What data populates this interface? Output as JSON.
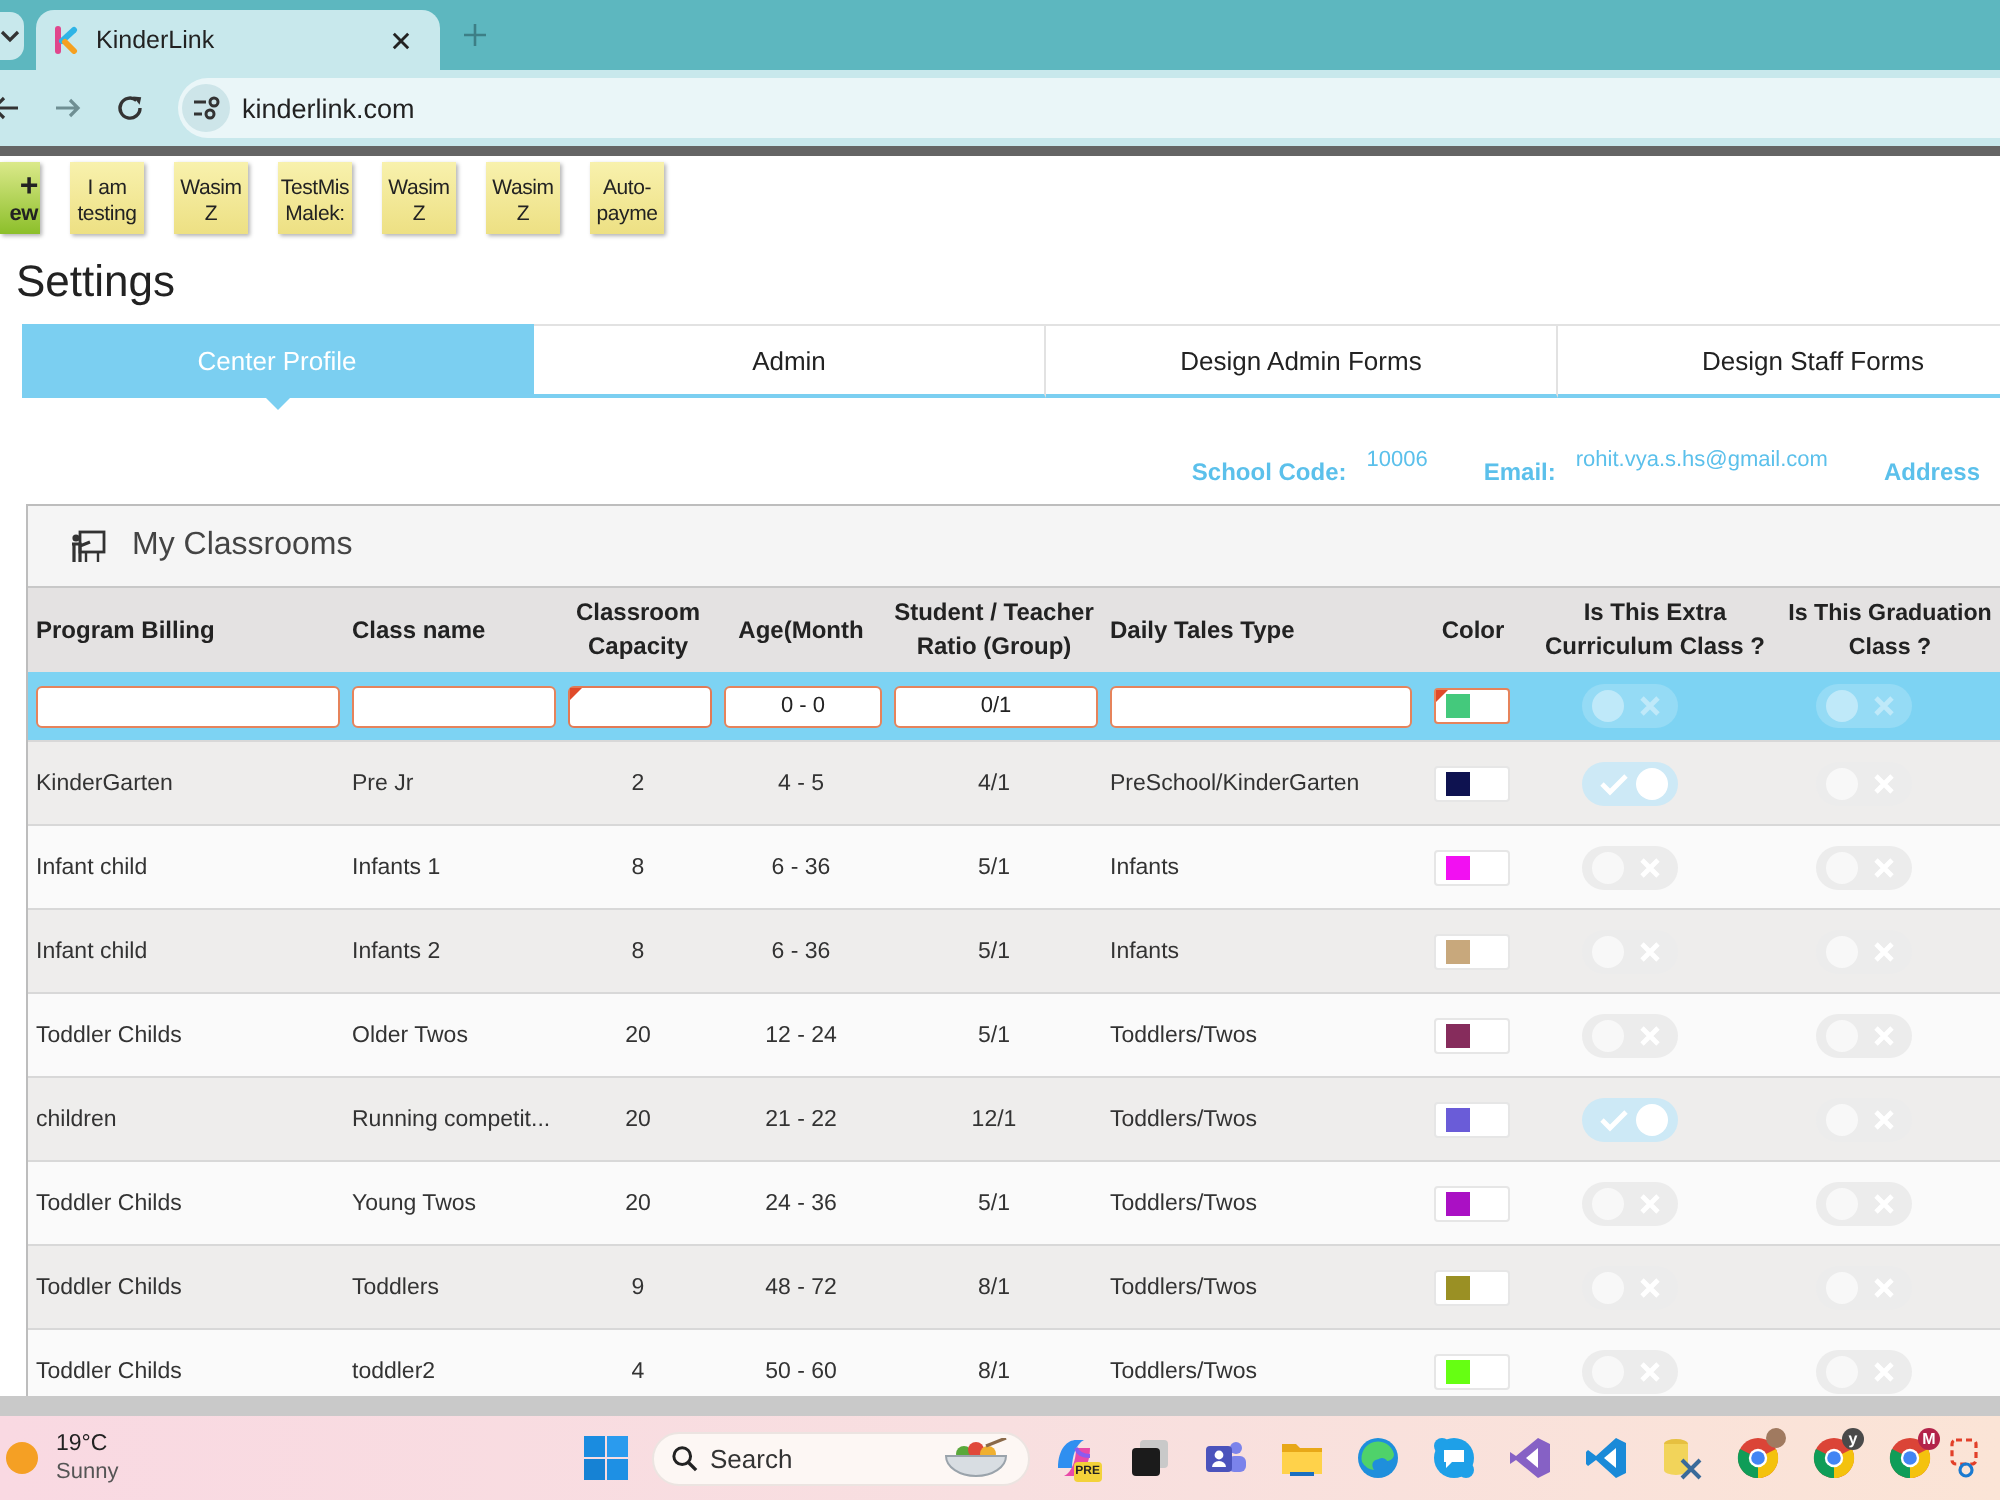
{
  "browser": {
    "tabs": [
      {
        "title": "KinderLink",
        "selected": true
      }
    ],
    "url": "kinderlink.com"
  },
  "sticky_notes": [
    {
      "kind": "add",
      "icon": "+",
      "text": "ew"
    },
    {
      "kind": "note",
      "text": "I am testing"
    },
    {
      "kind": "note",
      "text": "Wasim Z"
    },
    {
      "kind": "note",
      "text": "TestMis Malek:"
    },
    {
      "kind": "note",
      "text": "Wasim Z"
    },
    {
      "kind": "note",
      "text": "Wasim Z"
    },
    {
      "kind": "note",
      "text": "Auto-payme"
    }
  ],
  "page_title": "Settings",
  "tabs": [
    {
      "label": "Center Profile",
      "selected": true
    },
    {
      "label": "Admin",
      "selected": false
    },
    {
      "label": "Design Admin Forms",
      "selected": false
    },
    {
      "label": "Design Staff Forms",
      "selected": false
    }
  ],
  "school_info": [
    {
      "label": "School Code:",
      "value": "10006"
    },
    {
      "label": "Email:",
      "value": "rohit.vya.s.hs@gmail.com"
    },
    {
      "label": "Address"
    }
  ],
  "classrooms": {
    "title": "My Classrooms",
    "columns": [
      "Program Billing",
      "Class name",
      "Classroom Capacity",
      "Age(Month",
      "Student / Teacher Ratio (Group)",
      "Daily Tales Type",
      "Color",
      "Is This Extra Curriculum Class ?",
      "Is This Graduation Class ?"
    ],
    "new_row": {
      "fields": [
        {
          "required": false
        },
        {
          "required": false
        },
        {
          "required": true
        },
        {
          "value": "0 - 0",
          "required": false
        },
        {
          "value": "0/1",
          "required": false
        },
        {
          "required": false
        }
      ],
      "color": "#44c97c",
      "color_required": true,
      "extra_curriculum": false,
      "graduation": false
    },
    "rows": [
      {
        "program_billing": "KinderGarten",
        "class_name": "Pre Jr",
        "capacity": "2",
        "age": "4 - 5",
        "ratio": "4/1",
        "daily_tales_type": "PreSchool/KinderGarten",
        "color": "#0e1250",
        "extra_curriculum": true,
        "graduation": false
      },
      {
        "program_billing": "Infant child",
        "class_name": "Infants 1",
        "capacity": "8",
        "age": "6 - 36",
        "ratio": "5/1",
        "daily_tales_type": "Infants",
        "color": "#f210f2",
        "extra_curriculum": false,
        "graduation": false
      },
      {
        "program_billing": "Infant child",
        "class_name": "Infants 2",
        "capacity": "8",
        "age": "6 - 36",
        "ratio": "5/1",
        "daily_tales_type": "Infants",
        "color": "#c8a87c",
        "extra_curriculum": false,
        "graduation": false
      },
      {
        "program_billing": "Toddler Childs",
        "class_name": "Older Twos",
        "capacity": "20",
        "age": "12 - 24",
        "ratio": "5/1",
        "daily_tales_type": "Toddlers/Twos",
        "color": "#862c5c",
        "extra_curriculum": false,
        "graduation": false
      },
      {
        "program_billing": "children",
        "class_name": "Running competit...",
        "capacity": "20",
        "age": "21 - 22",
        "ratio": "12/1",
        "daily_tales_type": "Toddlers/Twos",
        "color": "#6a5cd8",
        "extra_curriculum": true,
        "graduation": false
      },
      {
        "program_billing": "Toddler Childs",
        "class_name": "Young Twos",
        "capacity": "20",
        "age": "24 - 36",
        "ratio": "5/1",
        "daily_tales_type": "Toddlers/Twos",
        "color": "#aa10c4",
        "extra_curriculum": false,
        "graduation": false
      },
      {
        "program_billing": "Toddler Childs",
        "class_name": "Toddlers",
        "capacity": "9",
        "age": "48 - 72",
        "ratio": "8/1",
        "daily_tales_type": "Toddlers/Twos",
        "color": "#9a9024",
        "extra_curriculum": false,
        "graduation": false
      },
      {
        "program_billing": "Toddler Childs",
        "class_name": "toddler2",
        "capacity": "4",
        "age": "50 - 60",
        "ratio": "8/1",
        "daily_tales_type": "Toddlers/Twos",
        "color": "#66ff12",
        "extra_curriculum": false,
        "graduation": false
      }
    ]
  },
  "taskbar": {
    "weather": {
      "temperature": "19°C",
      "condition": "Sunny"
    },
    "search_placeholder": "Search",
    "app_badges": [
      {
        "text": "PRE",
        "color": "#f3d23a"
      },
      {
        "text": "y",
        "color": "#4a4a4a"
      },
      {
        "text": "M",
        "color": "#b3234a"
      }
    ]
  }
}
